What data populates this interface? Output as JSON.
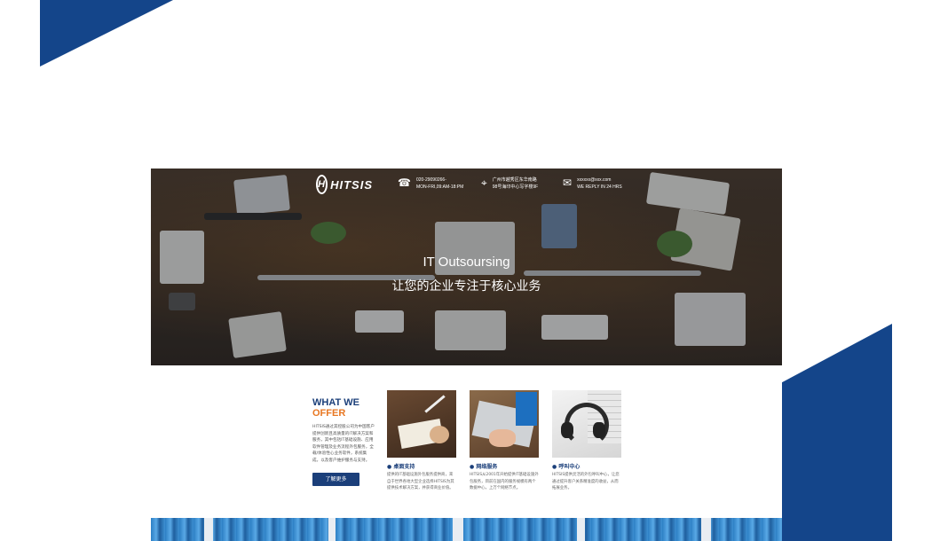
{
  "hero": {
    "logo": "HITSIS",
    "contacts": [
      {
        "icon": "phone-icon",
        "glyph": "☎",
        "line1": "020-29090266-",
        "line2": "MON-FRI,09:AM-18:PM"
      },
      {
        "icon": "location-pin-icon",
        "glyph": "⌖",
        "line1": "广州市越秀区东华南路",
        "line2": "98号海印中心写字楼9F"
      },
      {
        "icon": "mail-icon",
        "glyph": "✉",
        "line1": "xxxxxx@xxx.com",
        "line2": "WE REPLY IN 24 HRS"
      }
    ],
    "title_en": "IT Outsoursing",
    "title_cn": "让您的企业专注于核心业务"
  },
  "offer": {
    "heading_line1": "WHAT WE",
    "heading_line2": "OFFER",
    "description": "HITSIS通过其控股公司为中国客户提供创新且高质量的IT解决方案和服务，其中包括IT基础设施、应用软件管理及业务流程外包服务，全载/体验性心业务软件，系统集成，以及客户维护服务与支持。",
    "button_label": "了解更多"
  },
  "services": [
    {
      "title": "● 桌面支持",
      "desc": "提供的IT基础设施外包服务提供商，来自于世界各地大型企业选择HITSIS为其提供技术解决方案，并获得商业价值。"
    },
    {
      "title": "● 网络服务",
      "desc": "HITSIS从2001年开始提供IT基础设施外包服务，目前在国内的服务规模有两个数据中心，上万个网络节点。"
    },
    {
      "title": "● 呼叫中心",
      "desc": "HITSIS提供灵活的外包呼叫中心，让您通过提升客户关系精准度的收益，从而拓展业务。"
    }
  ],
  "colors": {
    "brand_blue": "#14458a",
    "accent_orange": "#e87722",
    "text_blue": "#1b3f7a"
  }
}
